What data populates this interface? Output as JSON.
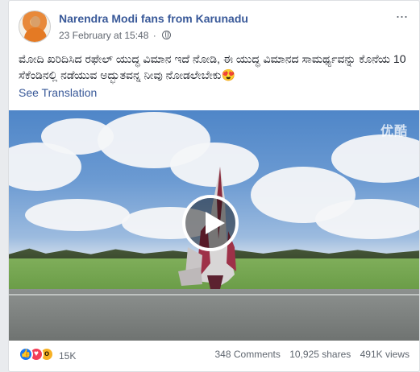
{
  "post": {
    "page_name": "Narendra Modi fans from Karunadu",
    "timestamp": "23 February at 15:48",
    "separator": "·",
    "text": "ಮೋದಿ ಖರಿದಿಸಿದ ರಫೇಲ್ ಯುದ್ಧ ವಿಮಾನ ಇದೆ ನೋಡಿ, ಈ ಯುದ್ಧ ವಿಮಾನದ ಸಾಮರ್ಥ್ಯವನ್ನು ಕೊನೆಯ 10 ಸೆಕೆಂಡಿನಲ್ಲಿ ನಡೆಯುವ ಅದ್ಭುತವನ್ನ ನೀವು ನೋಡಲೇಬೇಕು😍",
    "see_translation": "See Translation",
    "more_label": "···"
  },
  "video": {
    "watermark": "优酷"
  },
  "footer": {
    "reaction_icons": [
      "like-icon",
      "love-icon",
      "wow-icon"
    ],
    "reaction_count": "15K",
    "comments": "348 Comments",
    "shares": "10,925 shares",
    "views": "491K views"
  },
  "colors": {
    "link": "#385898",
    "like": "#1877f2",
    "love": "#f33e58",
    "wow": "#f7b125"
  }
}
